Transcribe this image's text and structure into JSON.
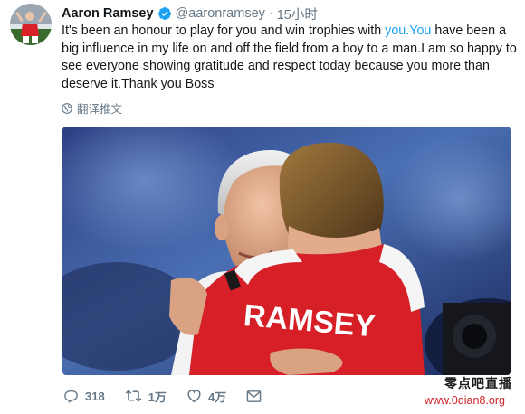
{
  "tweet": {
    "display_name": "Aaron Ramsey",
    "handle": "@aaronramsey",
    "separator": "·",
    "time": "15小时",
    "text_part1": "It's been an honour to play for you and win trophies with ",
    "mention": "you.You",
    "text_part2": " have been a big influence in my life on and off the field from a boy to a man.I am so happy to see everyone showing gratitude and respect today because you more than deserve it.Thank you Boss",
    "translate_label": "翻译推文",
    "jersey_text": "RAMSEY"
  },
  "actions": {
    "reply_icon": "reply-icon",
    "reply_count": "318",
    "retweet_icon": "retweet-icon",
    "retweet_count": "1万",
    "like_icon": "heart-icon",
    "like_count": "4万",
    "dm_icon": "envelope-icon"
  },
  "watermark": {
    "site_name": "零点吧直播",
    "url": "www.0dian8.org"
  },
  "colors": {
    "link": "#1da1f2",
    "muted": "#657786",
    "verified": "#1da1f2",
    "watermark_url": "#d2232a",
    "jersey_red": "#d61f26"
  }
}
